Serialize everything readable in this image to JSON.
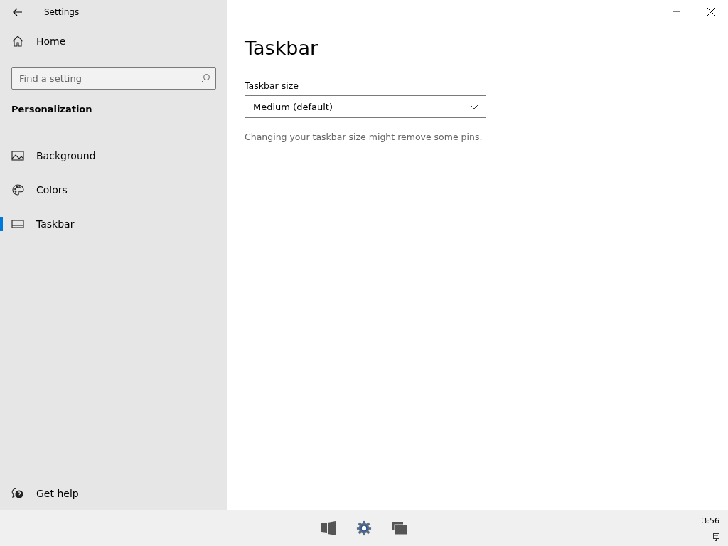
{
  "window": {
    "title": "Settings"
  },
  "sidebar": {
    "home": "Home",
    "search": {
      "placeholder": "Find a setting"
    },
    "section": "Personalization",
    "items": [
      {
        "label": "Background",
        "kind": "picture",
        "selected": false
      },
      {
        "label": "Colors",
        "kind": "palette",
        "selected": false
      },
      {
        "label": "Taskbar",
        "kind": "taskbar",
        "selected": true
      }
    ],
    "help": "Get help"
  },
  "content": {
    "title": "Taskbar",
    "field_label": "Taskbar size",
    "dropdown": {
      "value": "Medium (default)"
    },
    "note": "Changing your taskbar size might remove some pins."
  },
  "taskbar": {
    "clock": "3:56"
  }
}
